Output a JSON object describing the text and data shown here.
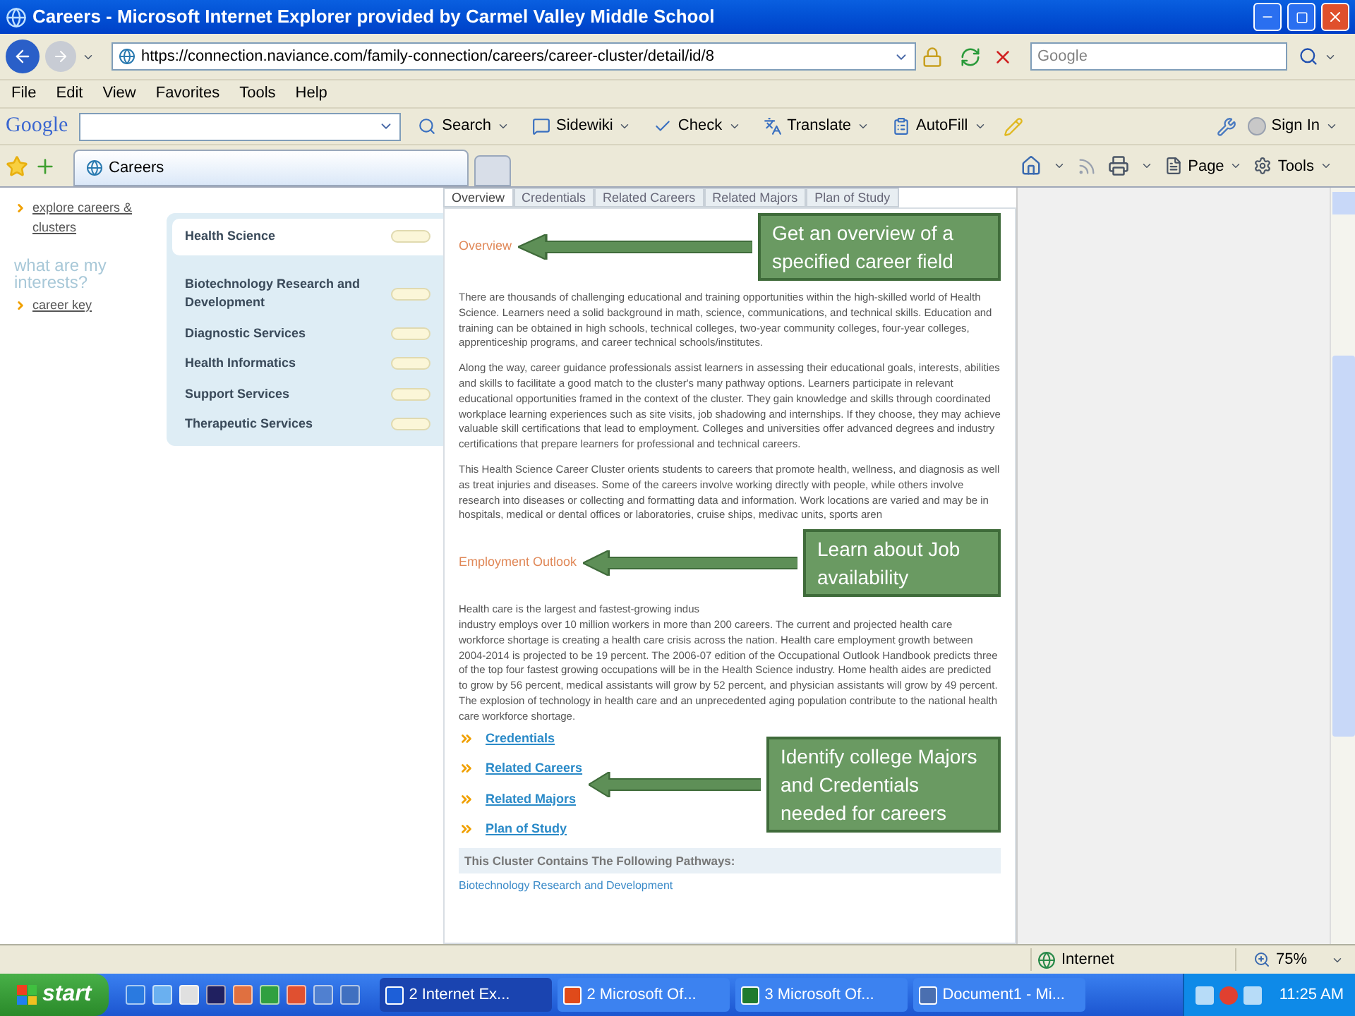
{
  "window": {
    "title": "Careers - Microsoft Internet Explorer provided by Carmel Valley Middle School"
  },
  "address_bar": {
    "url": "https://connection.naviance.com/family-connection/careers/career-cluster/detail/id/8"
  },
  "search_box": {
    "placeholder": "Google"
  },
  "menu": [
    "File",
    "Edit",
    "View",
    "Favorites",
    "Tools",
    "Help"
  ],
  "google_toolbar": {
    "logo": "Google",
    "buttons": [
      {
        "label": "Search",
        "kind": "search"
      },
      {
        "label": "Sidewiki",
        "kind": "sidewiki"
      },
      {
        "label": "Check",
        "kind": "check"
      },
      {
        "label": "Translate",
        "kind": "translate"
      },
      {
        "label": "AutoFill",
        "kind": "autofill"
      }
    ],
    "sign_in": "Sign In"
  },
  "browser_tabs": [
    {
      "label": "Careers",
      "selected": true
    }
  ],
  "command_bar": [
    {
      "label": "Page",
      "kind": "page"
    },
    {
      "label": "Tools",
      "kind": "tools"
    }
  ],
  "left_nav": {
    "links": [
      "explore careers & clusters"
    ],
    "heading": "what are my interests?",
    "links_2": [
      "career key"
    ]
  },
  "pathways": [
    {
      "label": "Health Science",
      "selected": true
    },
    {
      "label": "Biotechnology Research and Development",
      "selected": false
    },
    {
      "label": "Diagnostic Services",
      "selected": false
    },
    {
      "label": "Health Informatics",
      "selected": false
    },
    {
      "label": "Support Services",
      "selected": false
    },
    {
      "label": "Therapeutic Services",
      "selected": false
    }
  ],
  "content_tabs": [
    {
      "label": "Overview",
      "selected": true
    },
    {
      "label": "Credentials",
      "selected": false
    },
    {
      "label": "Related Careers",
      "selected": false
    },
    {
      "label": "Related Majors",
      "selected": false
    },
    {
      "label": "Plan of Study",
      "selected": false
    }
  ],
  "sections": [
    {
      "heading": "Overview",
      "paragraphs": [
        "There are thousands of challenging educational and training opportunities within the high-skilled world of Health Science. Learners need a solid background in math, science, communications, and technical skills. Education and training can be obtained in high schools, technical colleges, two-year community colleges, four-year colleges, apprenticeship programs, and career technical schools/institutes.",
        "Along the way, career guidance professionals assist learners in assessing their educational goals, interests, abilities and skills to facilitate a good match to the cluster's many pathway options. Learners participate in relevant educational opportunities framed in the context of the cluster. They gain knowledge and skills through coordinated workplace learning experiences such as site visits, job shadowing and internships. If they choose, they may achieve valuable skill certifications that lead to employment. Colleges and universities offer advanced degrees and industry certifications that prepare learners for professional and technical careers.",
        "This Health Science Career Cluster orients students to careers that promote health, wellness, and diagnosis as well as treat injuries and diseases. Some of the careers involve working directly with people, while others involve research into diseases or collecting and formatting data and information. Work locations are varied and may be in hospitals, medical or dental offices or laboratories, cruise ships, medivac units, sports aren"
      ]
    },
    {
      "heading": "Employment Outlook",
      "paragraphs": [
        "Health care is the largest and fastest-growing indus",
        "industry employs over 10 million workers in more than 200 careers. The current and projected health care workforce shortage is creating a health care crisis across the nation. Health care employment growth between 2004-2014 is projected to be 19 percent. The 2006-07 edition of the Occupational Outlook Handbook predicts three of the top four fastest growing occupations will be in the Health Science industry. Home health aides are predicted to grow by 56 percent, medical assistants will grow by 52 percent, and physician assistants will grow by 49 percent. The explosion of technology in health care and an unprecedented aging population contribute to the national health care workforce shortage."
      ]
    }
  ],
  "links": [
    "Credentials",
    "Related Careers",
    "Related Majors",
    "Plan of Study"
  ],
  "pathways_box": {
    "heading": "This Cluster Contains The Following Pathways:",
    "items": [
      "Biotechnology Research and Development"
    ]
  },
  "callouts": [
    "Get an overview of a specified career field",
    "Learn about Job availability",
    "Identify college Majors and Credentials needed for careers"
  ],
  "status_bar": {
    "zone": "Internet",
    "zoom": "75%"
  },
  "taskbar": {
    "start": "start",
    "tasks": [
      {
        "label": "2 Internet Ex...",
        "kind": "ie",
        "selected": true
      },
      {
        "label": "2 Microsoft Of...",
        "kind": "office",
        "selected": false
      },
      {
        "label": "3 Microsoft Of...",
        "kind": "excel",
        "selected": false
      },
      {
        "label": "Document1 - Mi...",
        "kind": "doc",
        "selected": false
      }
    ],
    "clock": "11:25 AM"
  }
}
